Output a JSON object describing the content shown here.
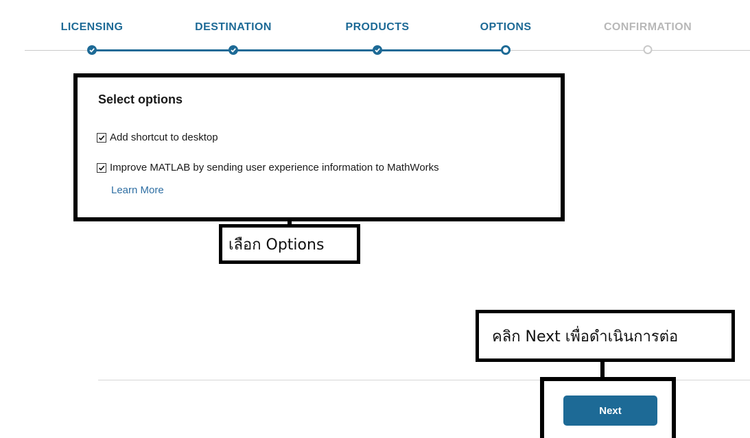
{
  "steps": [
    {
      "label": "LICENSING",
      "state": "done"
    },
    {
      "label": "DESTINATION",
      "state": "done"
    },
    {
      "label": "PRODUCTS",
      "state": "done"
    },
    {
      "label": "OPTIONS",
      "state": "current"
    },
    {
      "label": "CONFIRMATION",
      "state": "pending"
    }
  ],
  "options": {
    "title": "Select options",
    "items": [
      {
        "label": "Add shortcut to desktop",
        "checked": true
      },
      {
        "label": "Improve MATLAB by sending user experience information to MathWorks",
        "checked": true
      }
    ],
    "learn_more": "Learn More"
  },
  "annotations": {
    "options_note": "เลือก Options",
    "next_note": "คลิก Next เพื่อดำเนินการต่อ"
  },
  "footer": {
    "next_label": "Next"
  },
  "colors": {
    "accent": "#1d6a96",
    "pending": "#b8b8b8",
    "link": "#2f6fa3"
  }
}
